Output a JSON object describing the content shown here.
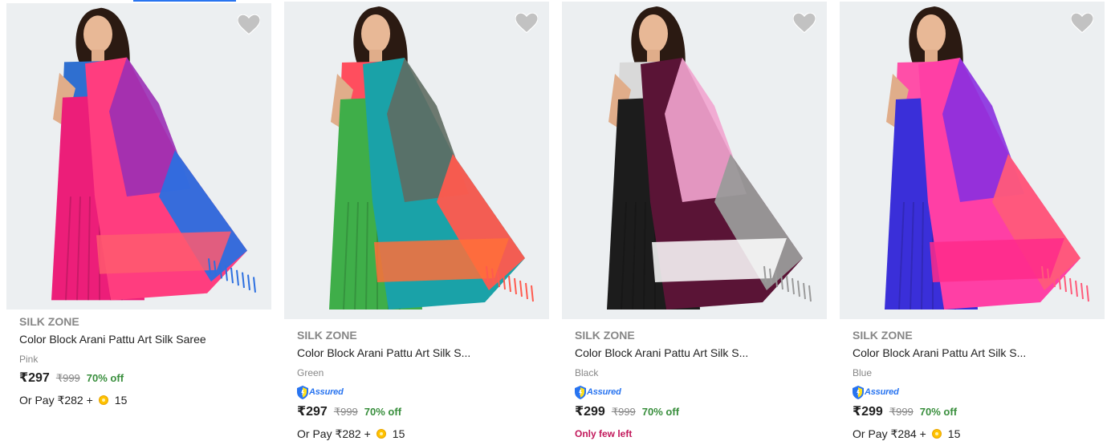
{
  "products": [
    {
      "brand": "SILK ZONE",
      "title": "Color Block Arani Pattu Art Silk Saree",
      "variant": "Pink",
      "assured": false,
      "price": "₹297",
      "mrp": "₹999",
      "discount": "70% off",
      "pay_text": "Or Pay ₹282 +",
      "coins": "15",
      "stock_note": "",
      "colors": {
        "blouse": "#2f6fd0",
        "drape": "#ec1e79",
        "pallu1": "#ff3d7f",
        "pallu2": "#9b2fb5",
        "pallu3": "#2c6fe0",
        "band": "#ff5a6e"
      }
    },
    {
      "brand": "SILK ZONE",
      "title": "Color Block Arani Pattu Art Silk S...",
      "variant": "Green",
      "assured": true,
      "assured_label": "Assured",
      "price": "₹297",
      "mrp": "₹999",
      "discount": "70% off",
      "pay_text": "Or Pay ₹282 +",
      "coins": "15",
      "stock_note": "",
      "colors": {
        "blouse": "#ff4e5e",
        "drape": "#3fae49",
        "pallu1": "#1aa2a8",
        "pallu2": "#5f6b62",
        "pallu3": "#ff5a4e",
        "band": "#ff6e3a"
      }
    },
    {
      "brand": "SILK ZONE",
      "title": "Color Block Arani Pattu Art Silk S...",
      "variant": "Black",
      "assured": true,
      "assured_label": "Assured",
      "price": "₹299",
      "mrp": "₹999",
      "discount": "70% off",
      "pay_text": "",
      "coins": "",
      "stock_note": "Only few left",
      "colors": {
        "blouse": "#d9d9d9",
        "drape": "#1c1c1c",
        "pallu1": "#5a1436",
        "pallu2": "#f2a4cf",
        "pallu3": "#9a9a9a",
        "band": "#ffffff"
      }
    },
    {
      "brand": "SILK ZONE",
      "title": "Color Block Arani Pattu Art Silk S...",
      "variant": "Blue",
      "assured": true,
      "assured_label": "Assured",
      "price": "₹299",
      "mrp": "₹999",
      "discount": "70% off",
      "pay_text": "Or Pay ₹284 +",
      "coins": "15",
      "stock_note": "",
      "colors": {
        "blouse": "#ff4fa8",
        "drape": "#3a2fd9",
        "pallu1": "#ff3fa5",
        "pallu2": "#8a2fe0",
        "pallu3": "#ff5a7a",
        "band": "#ff2a8a"
      }
    }
  ]
}
